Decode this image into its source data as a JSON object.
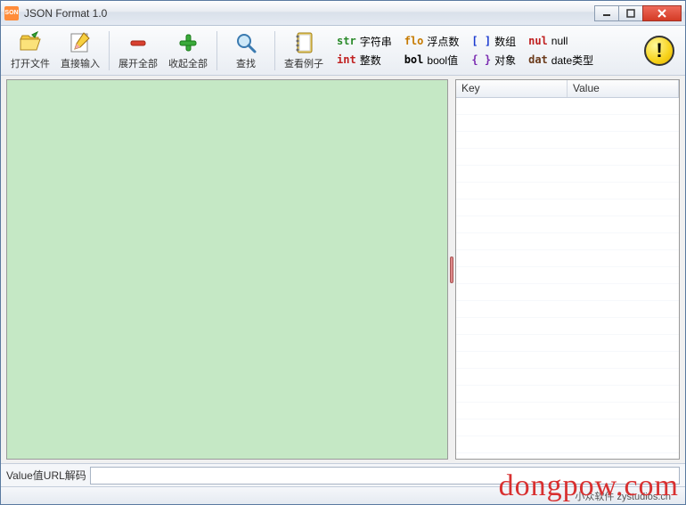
{
  "window": {
    "title": "JSON Format 1.0",
    "app_icon_text": "SON"
  },
  "toolbar": {
    "open_file": "打开文件",
    "direct_input": "直接输入",
    "expand_all": "展开全部",
    "collapse_all": "收起全部",
    "search": "查找",
    "view_examples": "查看例子"
  },
  "legend": {
    "str": {
      "tag": "str",
      "label": "字符串",
      "color": "#2a8a2a"
    },
    "flo": {
      "tag": "flo",
      "label": "浮点数",
      "color": "#c67a00"
    },
    "arr": {
      "tag": "[ ]",
      "label": "数组",
      "color": "#1a3ad0"
    },
    "nul": {
      "tag": "nul",
      "label": "null",
      "color": "#c02020"
    },
    "int": {
      "tag": "int",
      "label": "整数",
      "color": "#c02020"
    },
    "bol": {
      "tag": "bol",
      "label": "bool值",
      "color": "#000"
    },
    "obj": {
      "tag": "{ }",
      "label": "对象",
      "color": "#7a2ab0"
    },
    "dat": {
      "tag": "dat",
      "label": "date类型",
      "color": "#6a3a1a"
    }
  },
  "kv_panel": {
    "key_header": "Key",
    "value_header": "Value"
  },
  "bottom": {
    "label": "Value值URL解码",
    "value": ""
  },
  "status": {
    "text": "小众软件 zystudios.cn"
  },
  "watermark": "dongpow.com"
}
